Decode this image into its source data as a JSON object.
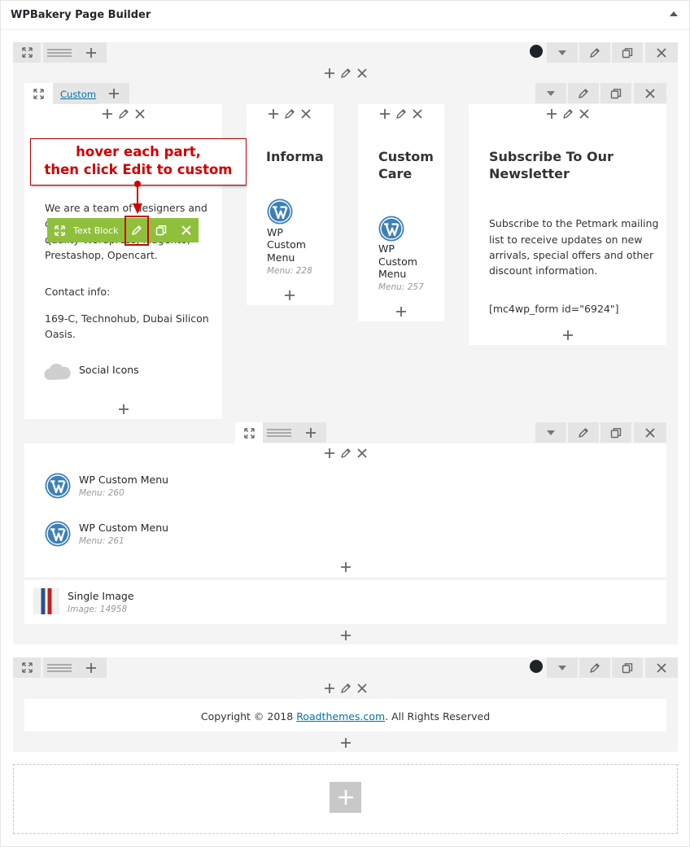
{
  "builder": {
    "title": "WPBakery Page Builder"
  },
  "tab": {
    "label": "Custom"
  },
  "callout": {
    "line1": "hover each part,",
    "line2": "then click Edit to custom"
  },
  "col1": {
    "text_part1": "We are a team of designers and",
    "text_part1b": "d",
    "text_part2": "quality Wordpress, Magento,",
    "text_part3": "Prestashop, Opencart.",
    "contact_label": "Contact info:",
    "address_line1": "169-C, Technohub, Dubai Silicon",
    "address_line2": "Oasis.",
    "social_label": "Social Icons"
  },
  "toolbar": {
    "label": "Text Block"
  },
  "col2": {
    "heading": "Informa",
    "name_line1": "WP",
    "name_line2": "Custom",
    "name_line3": "Menu",
    "meta": "Menu: 228"
  },
  "col3": {
    "heading_line1": "Custom",
    "heading_line2": "Care",
    "name_line1": "WP",
    "name_line2": "Custom",
    "name_line3": "Menu",
    "meta": "Menu: 257"
  },
  "col4": {
    "heading_line1": "Subscribe To Our",
    "heading_line2": "Newsletter",
    "body_line1": "Subscribe to the Petmark mailing",
    "body_line2": "list to receive updates on new",
    "body_line3": "arrivals, special offers and other",
    "body_line4": "discount information.",
    "shortcode": "[mc4wp_form id=\"6924\"]"
  },
  "inner": {
    "menu1_name": "WP Custom Menu",
    "menu1_meta": "Menu: 260",
    "menu2_name": "WP Custom Menu",
    "menu2_meta": "Menu: 261"
  },
  "image": {
    "name": "Single Image",
    "meta": "Image: 14958"
  },
  "footer": {
    "copyright_pre": "Copyright © 2018 ",
    "link": "Roadthemes.com",
    "copyright_post": ". All Rights Reserved"
  },
  "colors": {
    "accent": "#8fc03c",
    "callout": "#d00000",
    "link": "#0073aa",
    "wpblue": "#3d80b7"
  }
}
